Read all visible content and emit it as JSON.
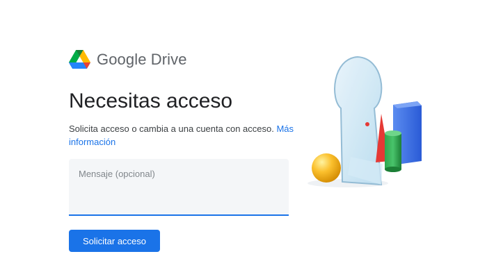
{
  "brand": {
    "name": "Google Drive"
  },
  "page": {
    "title": "Necesitas acceso",
    "description": "Solicita acceso o cambia a una cuenta con acceso.",
    "more_info_link": "Más información"
  },
  "message": {
    "placeholder": "Mensaje (opcional)",
    "value": ""
  },
  "actions": {
    "request_label": "Solicitar acceso"
  },
  "colors": {
    "accent": "#1a73e8",
    "field_bg": "#f4f6f8"
  },
  "icons": {
    "brand": "google-drive-logo-icon",
    "illustration": "keyhole-illustration"
  }
}
